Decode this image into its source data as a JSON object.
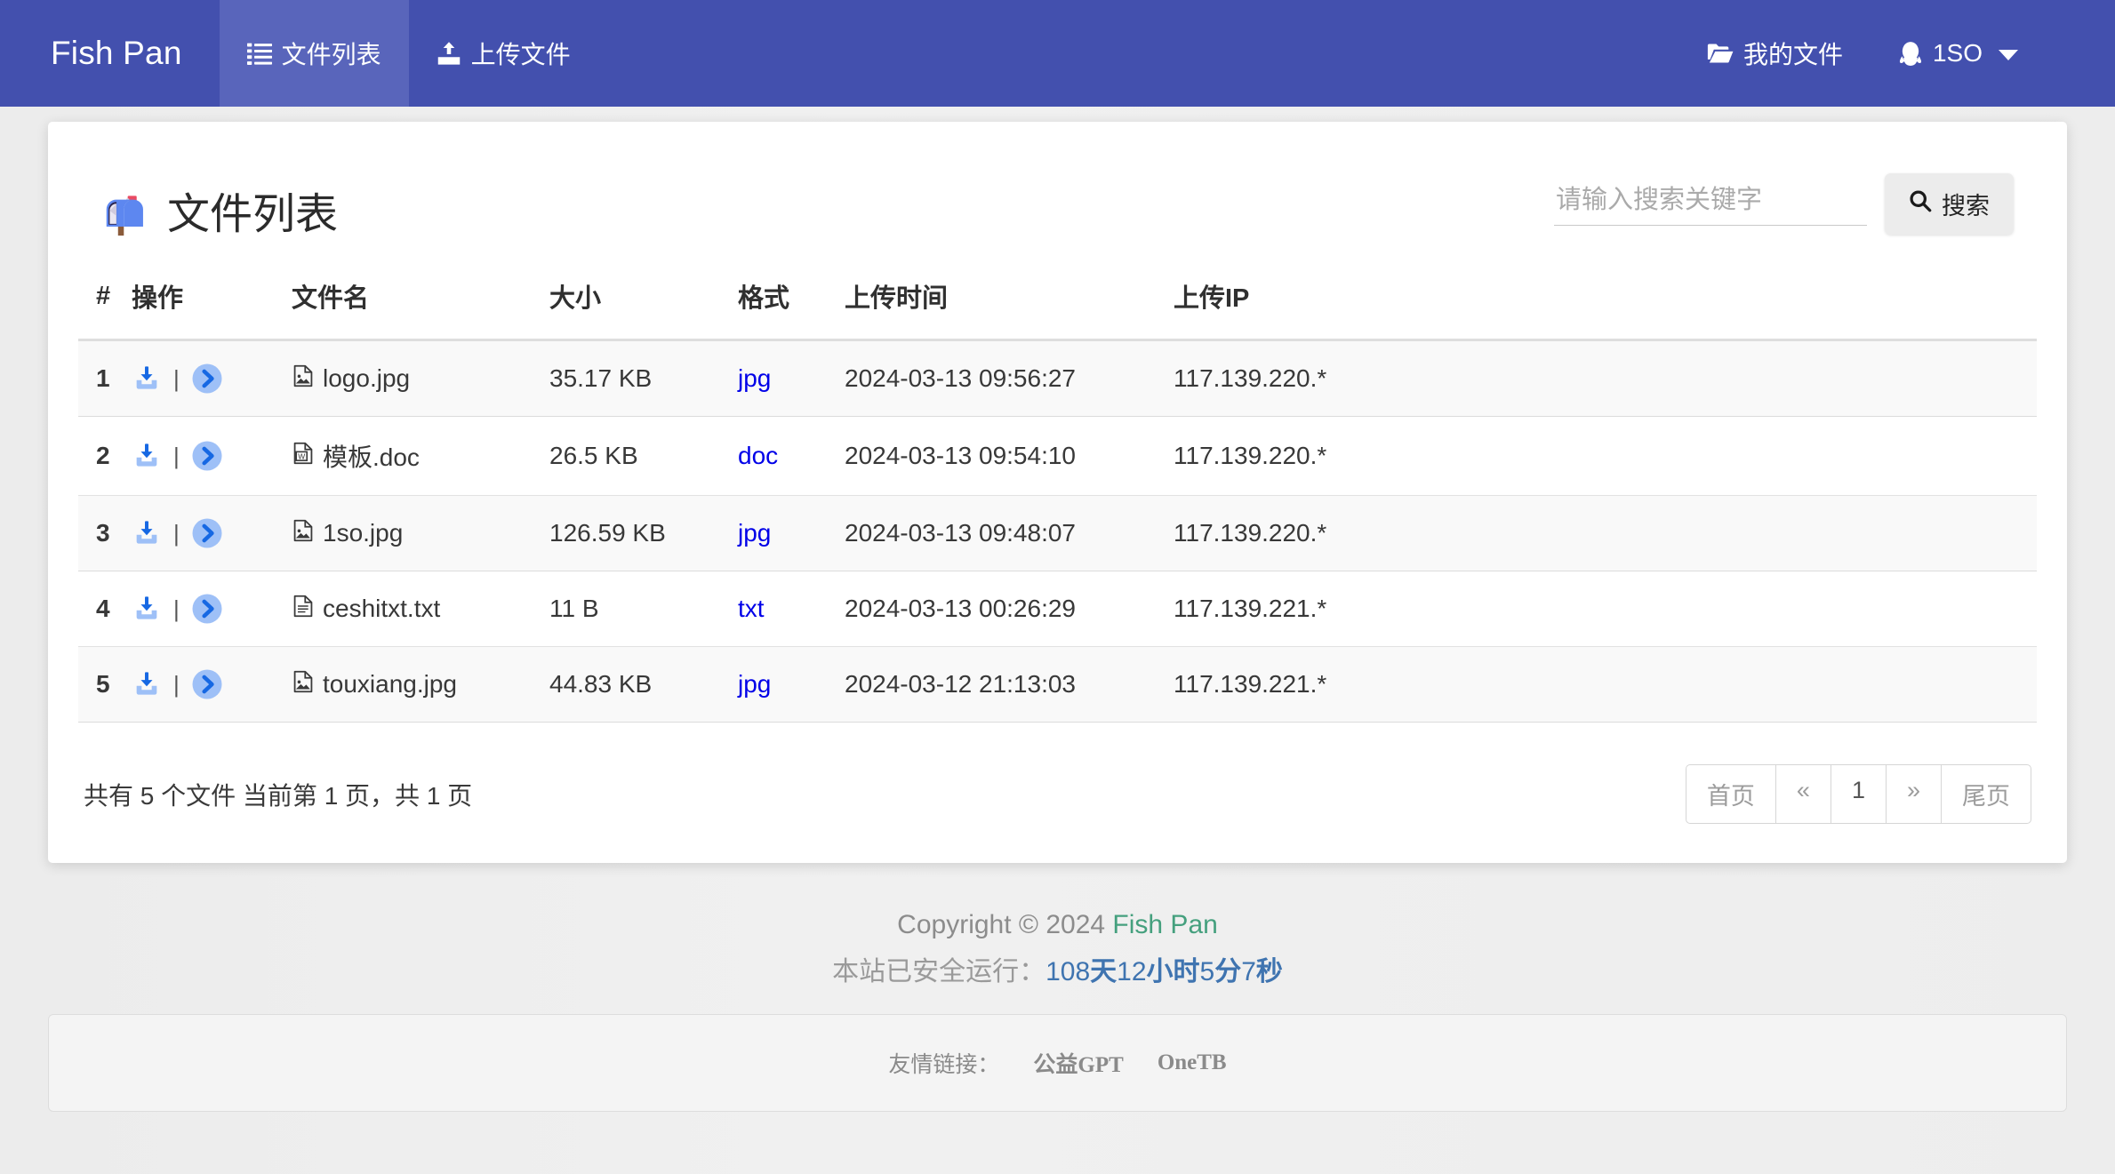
{
  "navbar": {
    "brand": "Fish Pan",
    "items": [
      {
        "label": "文件列表",
        "icon": "list-icon",
        "active": true
      },
      {
        "label": "上传文件",
        "icon": "upload-icon",
        "active": false
      }
    ],
    "right": [
      {
        "label": "我的文件",
        "icon": "folder-open-icon"
      },
      {
        "label": "1SO",
        "icon": "qq-penguin-icon",
        "caret": true
      }
    ],
    "bg_color": "#4350ae",
    "active_color": "#5965bb"
  },
  "page": {
    "title": "文件列表",
    "title_icon": "mailbox-icon"
  },
  "search": {
    "placeholder": "请输入搜索关键字",
    "value": "",
    "button_label": "搜索",
    "button_icon": "search-icon"
  },
  "table": {
    "headers": [
      "#",
      "操作",
      "文件名",
      "大小",
      "格式",
      "上传时间",
      "上传IP"
    ],
    "row_actions": [
      "download-icon",
      "forward-icon"
    ],
    "rows": [
      {
        "num": "1",
        "file_icon": "image-file-icon",
        "name": "logo.jpg",
        "size": "35.17 KB",
        "format": "jpg",
        "time": "2024-03-13 09:56:27",
        "ip": "117.139.220.*"
      },
      {
        "num": "2",
        "file_icon": "word-file-icon",
        "name": "模板.doc",
        "size": "26.5 KB",
        "format": "doc",
        "time": "2024-03-13 09:54:10",
        "ip": "117.139.220.*"
      },
      {
        "num": "3",
        "file_icon": "image-file-icon",
        "name": "1so.jpg",
        "size": "126.59 KB",
        "format": "jpg",
        "time": "2024-03-13 09:48:07",
        "ip": "117.139.220.*"
      },
      {
        "num": "4",
        "file_icon": "text-file-icon",
        "name": "ceshitxt.txt",
        "size": "11 B",
        "format": "txt",
        "time": "2024-03-13 00:26:29",
        "ip": "117.139.221.*"
      },
      {
        "num": "5",
        "file_icon": "image-file-icon",
        "name": "touxiang.jpg",
        "size": "44.83 KB",
        "format": "jpg",
        "time": "2024-03-12 21:13:03",
        "ip": "117.139.221.*"
      }
    ]
  },
  "pagination": {
    "summary": "共有 5 个文件  当前第 1 页，共 1 页",
    "buttons": [
      "首页",
      "«",
      "1",
      "»",
      "尾页"
    ]
  },
  "footer": {
    "copyright_prefix": "Copyright © 2024 ",
    "copyright_brand": "Fish Pan",
    "uptime_label": "本站已安全运行：",
    "uptime_days_num": "108",
    "uptime_days_unit": "天",
    "uptime_hours_num": "12",
    "uptime_hours_unit": "小时",
    "uptime_mins_num": "5",
    "uptime_mins_unit": "分",
    "uptime_secs_num": "7",
    "uptime_secs_unit": "秒",
    "links_label": "友情链接：",
    "links": [
      "公益GPT",
      "OneTB"
    ]
  }
}
